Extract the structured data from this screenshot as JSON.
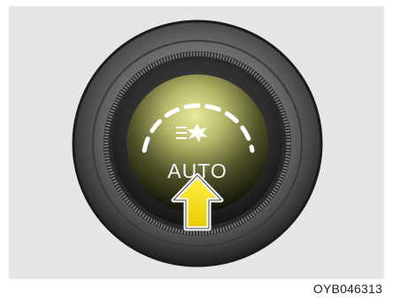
{
  "illustration": {
    "button_label": "AUTO",
    "figure_code": "OYB046313",
    "icons": {
      "indicator": "light-burst-icon",
      "action": "press-arrow-icon"
    },
    "colors": {
      "background": "#e6e6e6",
      "bezel_dark": "#2a2a2a",
      "bezel_mid": "#6e6e6e",
      "face_glow": "#d9dc8e",
      "face_dark": "#1d1f12",
      "arc_dashes": "#ffffff",
      "arrow_fill": "#f6e400",
      "arrow_outline": "#ffffff"
    }
  }
}
